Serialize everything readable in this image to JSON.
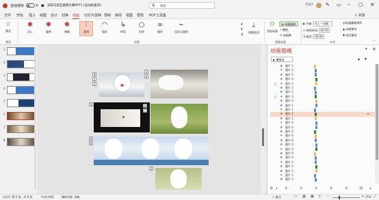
{
  "titlebar": {
    "autosave_label": "自动保存",
    "toggle_state": "关",
    "doc_title": "法院马骁互联网大赛PPT1 [自动恢复的]",
    "search_placeholder": "搜索",
    "user": "7127"
  },
  "tabs": [
    "文件",
    "开始",
    "插入",
    "绘图",
    "设计",
    "切换",
    "动画",
    "幻灯片放映",
    "录制",
    "审阅",
    "视图",
    "帮助",
    "PDF工具集"
  ],
  "active_tab": "动画",
  "share_label": "共享",
  "ribbon": {
    "preview_label": "预览",
    "preview_group": "预览",
    "effects": [
      "浮入",
      "旋转",
      "弹跳",
      "直线",
      "弧形",
      "转弯",
      "形状",
      "循环",
      "自定义路径"
    ],
    "effect_options": "效果选项",
    "animation_group": "动画",
    "add_animation": "添加动画",
    "animation_pane": "动画窗格",
    "trigger": "触发",
    "painter": "动画刷",
    "adv_group": "高级动画",
    "start_label": "开始:",
    "start_value": "与上一动画...",
    "duration_label": "持续时间:",
    "duration_value": "00.50",
    "delay_label": "延迟:",
    "delay_value": "00.00",
    "timing_group": "计时",
    "reorder": "对动画重新排序",
    "move_earlier": "向前移动",
    "move_later": "向后移动"
  },
  "slides": [
    "1",
    "2",
    "3",
    "4",
    "5",
    "6",
    "7",
    "8"
  ],
  "canvas_badges": [
    "0",
    "1",
    "2",
    "3",
    "4",
    "5",
    "6",
    "7",
    "8",
    "9",
    "2"
  ],
  "pane": {
    "title": "动画窗格",
    "play_label": "播放自",
    "items": [
      {
        "num": "",
        "label": "图片 5"
      },
      {
        "num": "",
        "label": "图片 5"
      },
      {
        "num": "",
        "label": "图片 5"
      },
      {
        "num": "",
        "label": "图片 4"
      },
      {
        "num": "1",
        "label": "图片 2"
      },
      {
        "num": "",
        "label": "图片 2"
      },
      {
        "num": "",
        "label": "图片 2"
      },
      {
        "num": "2",
        "label": "图片 3"
      },
      {
        "num": "",
        "label": "图片 3"
      },
      {
        "num": "",
        "label": "图片 1"
      },
      {
        "num": "",
        "label": "图片 1"
      },
      {
        "num": "",
        "label": "图片 1"
      },
      {
        "num": "",
        "label": "图片 1"
      },
      {
        "num": "",
        "label": "图片 4"
      },
      {
        "num": "",
        "label": "图片 4"
      },
      {
        "num": "",
        "label": "图片 4"
      },
      {
        "num": "",
        "label": "图片 6"
      },
      {
        "num": "",
        "label": "图片 6"
      },
      {
        "num": "",
        "label": "图片 6"
      },
      {
        "num": "",
        "label": "图片 4"
      },
      {
        "num": "",
        "label": "图片 6"
      },
      {
        "num": "",
        "label": "图片 4"
      },
      {
        "num": "",
        "label": "图片 4"
      },
      {
        "num": "",
        "label": "图片 5"
      },
      {
        "num": "",
        "label": "图片 5"
      },
      {
        "num": "",
        "label": "图片 1"
      },
      {
        "num": "",
        "label": "图片 1"
      }
    ],
    "selected_index": 11,
    "seconds_label": "秒",
    "tick_labels": [
      "0",
      "2",
      "4",
      "6",
      "8",
      "10"
    ]
  },
  "status": {
    "slide_info": "幻灯片 第 6 张，共 8 张",
    "language": "中文(中国)",
    "accessibility": "辅助功能: 调查",
    "notes": "备注",
    "zoom": "25%"
  },
  "colors": {
    "accent": "#c0392b",
    "green": "#2a8a3c",
    "blue": "#5b8bd0",
    "yellow": "#e6c34a",
    "selected": "#f9d6c6"
  }
}
